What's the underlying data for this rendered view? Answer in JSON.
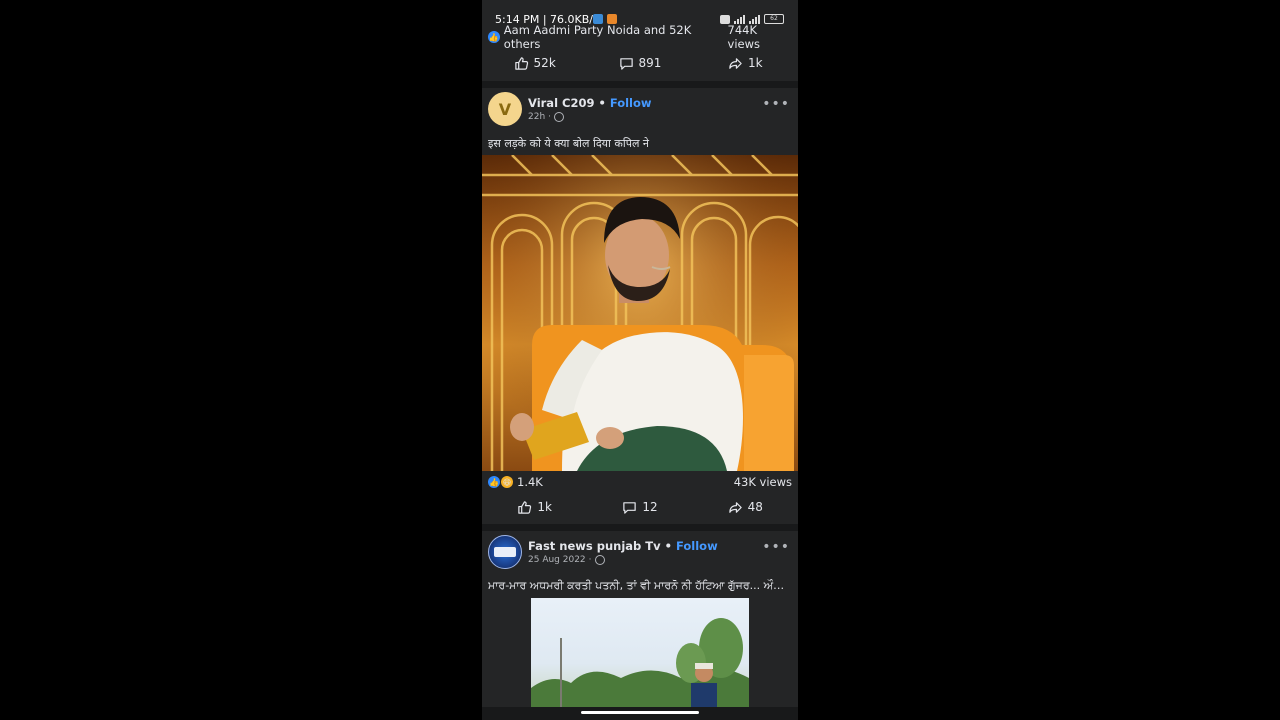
{
  "status_bar": {
    "time": "5:14 PM | 76.0KB/s",
    "battery": "62"
  },
  "prev_post": {
    "reactions_text": "Aam Aadmi Party Noida and 52K others",
    "views": "744K views",
    "like_count": "52k",
    "comment_count": "891",
    "share_count": "1k"
  },
  "post1": {
    "avatar_letter": "V",
    "author": "Viral C209",
    "follow_label": "Follow",
    "time": "22h",
    "caption": "इस लड़के को ये क्या बोल दिया कपिल ने",
    "reactions_count": "1.4K",
    "views": "43K views",
    "like_count": "1k",
    "comment_count": "12",
    "share_count": "48"
  },
  "post2": {
    "author": "Fast news punjab Tv",
    "follow_label": "Follow",
    "time": "25 Aug 2022",
    "caption": "ਮਾਰ-ਮਾਰ ਅਧਮਰੀ ਕਰਤੀ ਪਤਨੀ, ਤਾਂ ਵੀ ਮਾਰਨੋ ਨੀ ਹੱਟਿਆ ਗੁੱਜਰ... ਔਰਤ ..."
  },
  "colors": {
    "background": "#18191a",
    "card": "#242526",
    "accent": "#4599ff",
    "like_blue": "#2d88ff"
  }
}
